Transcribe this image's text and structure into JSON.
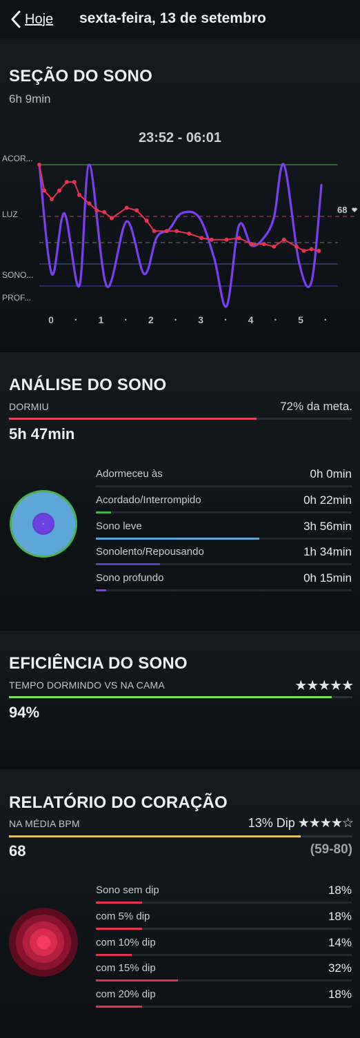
{
  "nav": {
    "back_label": "Hoje",
    "title": "sexta-feira, 13 de setembro"
  },
  "sleep_session": {
    "title": "SEÇÃO DO SONO",
    "duration": "6h 9min",
    "time_range": "23:52 - 06:01",
    "y_labels": [
      "ACOR...",
      "LUZ",
      "SONO...",
      "PROF..."
    ],
    "x_labels": [
      "0",
      "·",
      "1",
      "·",
      "2",
      "·",
      "3",
      "·",
      "4",
      "·",
      "5",
      "·"
    ],
    "hr_end_label": "68",
    "colors": {
      "awake": "#4caf50",
      "light": "#5fa6d8",
      "drowsy": "#5c3fc9",
      "deep": "#7b3ff2",
      "heart": "#e8334f"
    }
  },
  "chart_data": {
    "type": "line",
    "title": "",
    "xlabel": "",
    "ylabel": "",
    "x_ticks": [
      "0",
      "·",
      "1",
      "·",
      "2",
      "·",
      "3",
      "·",
      "4",
      "·",
      "5",
      "·"
    ],
    "y_ticks": [
      "ACOR...",
      "LUZ",
      "SONO...",
      "PROF..."
    ],
    "series": [
      {
        "name": "",
        "description_color": "#5fa6d8",
        "x": [
          0,
          0.25,
          0.5,
          0.8,
          1.0,
          1.35,
          1.75,
          2.1,
          2.35,
          2.6,
          2.85,
          3.2,
          3.5,
          3.75,
          4.0,
          4.25,
          4.5,
          4.7,
          4.9,
          5.2,
          5.45,
          5.65
        ],
        "y": [
          3.0,
          0.3,
          1.8,
          0.0,
          3.0,
          0.0,
          1.6,
          0.3,
          1.2,
          1.4,
          1.8,
          1.7,
          0.7,
          -0.5,
          1.5,
          1.0,
          1.2,
          1.7,
          3.0,
          0.6,
          0.1,
          2.5
        ]
      },
      {
        "name": "",
        "description_color": "#e8334f",
        "x": [
          0.0,
          0.1,
          0.25,
          0.4,
          0.55,
          0.7,
          0.8,
          1.0,
          1.15,
          1.3,
          1.45,
          1.75,
          1.95,
          2.15,
          2.3,
          2.55,
          2.75,
          3.0,
          3.25,
          3.45,
          3.75,
          4.0,
          4.25,
          4.5,
          4.7,
          4.9,
          5.15,
          5.3,
          5.45,
          5.6
        ],
        "y": [
          74,
          71,
          70,
          71,
          72,
          72,
          70.5,
          69.5,
          68.7,
          68.5,
          67.8,
          69,
          68.7,
          67.5,
          66.3,
          66.3,
          66.3,
          66,
          65.5,
          65.3,
          65.3,
          65.5,
          64.8,
          64.8,
          64.5,
          65.3,
          64.5,
          64,
          64.2,
          64.0
        ]
      }
    ],
    "annotations": [
      "68"
    ]
  },
  "analysis": {
    "title": "ANÁLISE DO SONO",
    "label": "DORMIU",
    "goal_text": "72% da meta.",
    "goal_progress": 0.72,
    "value": "5h 47min",
    "rows": [
      {
        "label": "Adormeceu às",
        "value": "0h 0min",
        "progress": 0.0,
        "color": "#4caf50"
      },
      {
        "label": "Acordado/Interrompido",
        "value": "0h 22min",
        "progress": 0.06,
        "color": "#4caf50"
      },
      {
        "label": "Sono leve",
        "value": "3h 56min",
        "progress": 0.64,
        "color": "#5fa6d8"
      },
      {
        "label": "Sonolento/Repousando",
        "value": "1h 34min",
        "progress": 0.25,
        "color": "#5c3fc9"
      },
      {
        "label": "Sono profundo",
        "value": "0h 15min",
        "progress": 0.04,
        "color": "#7b3ff2"
      }
    ]
  },
  "efficiency": {
    "title": "EFICIÊNCIA DO SONO",
    "label": "TEMPO DORMINDO VS NA CAMA",
    "stars": "★★★★★",
    "rating": 5,
    "value": "94%",
    "progress": 0.94,
    "color": "#7ddc5c"
  },
  "heart": {
    "title": "RELATÓRIO DO CORAÇÃO",
    "label": "NA MÉDIA BPM",
    "dip_text": "13% Dip",
    "stars": "★★★★☆",
    "rating": 4,
    "value": "68",
    "range": "(59-80)",
    "progress": 0.85,
    "color": "#e6c15a",
    "rows": [
      {
        "label": "Sono sem dip",
        "value": "18%",
        "progress": 0.18
      },
      {
        "label": "com 5% dip",
        "value": "18%",
        "progress": 0.18
      },
      {
        "label": "com 10% dip",
        "value": "14%",
        "progress": 0.14
      },
      {
        "label": "com 15% dip",
        "value": "32%",
        "progress": 0.32
      },
      {
        "label": "com 20% dip",
        "value": "18%",
        "progress": 0.18
      }
    ],
    "row_color": "#e8334f"
  }
}
